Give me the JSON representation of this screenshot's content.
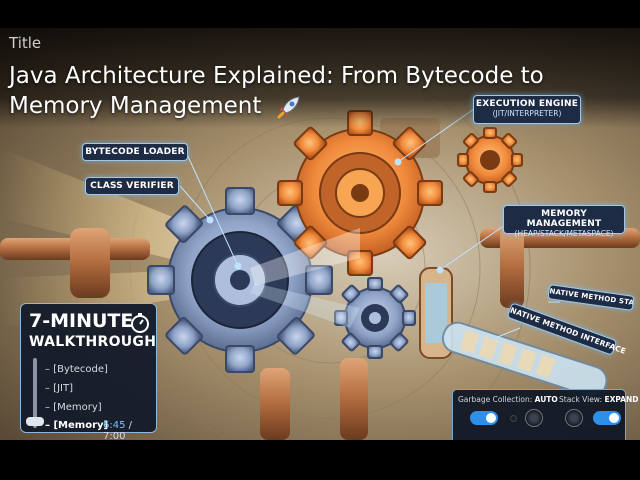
{
  "header": {
    "tag": "Title",
    "title": "Java Architecture Explained: From Bytecode to Memory Management"
  },
  "callouts": {
    "bytecode_loader": "BYTECODE LOADER",
    "class_verifier": "CLASS VERIFIER",
    "execution_engine": "EXECUTION ENGINE",
    "execution_engine_sub": "(JIT/INTERPRETER)",
    "memory_management": "MEMORY MANAGEMENT",
    "memory_management_sub": "(HEAP/STACK/METASPACE)",
    "native_method_stack": "NATIVE METHOD STACK",
    "native_method_interface": "NATIVE METHOD INTERFACE"
  },
  "walkthrough": {
    "title_line1": "7-MINUTE",
    "title_line2": "WALKTHROUGH",
    "steps": [
      {
        "label": "– [Bytecode]"
      },
      {
        "label": "– [JIT]"
      },
      {
        "label": "– [Memory]"
      },
      {
        "label": "– [Memory]"
      }
    ],
    "progress": {
      "current": "6:45",
      "separator": " / ",
      "total": "7:00",
      "fraction": 0.964
    }
  },
  "controls": {
    "gc_label": "Garbage Collection:",
    "gc_value": "AUTO",
    "stack_label": "Stack View:",
    "stack_value": "EXPAND"
  },
  "colors": {
    "accent": "#2d8fe8",
    "panel": "#1d2b45",
    "orange_gear": "#f08a3c",
    "blue_gear": "#8fa3c8"
  }
}
